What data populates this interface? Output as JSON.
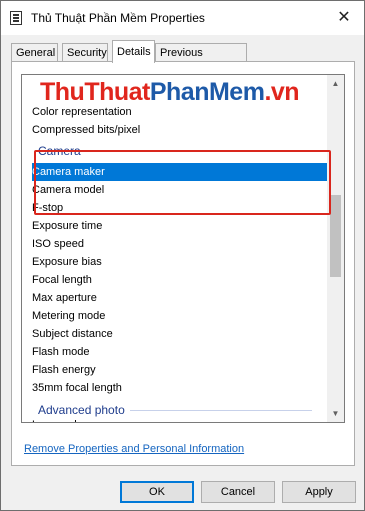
{
  "window": {
    "title": "Thủ Thuật Phần Mềm Properties",
    "close_glyph": "✕"
  },
  "tabs": [
    {
      "label": "General"
    },
    {
      "label": "Security"
    },
    {
      "label": "Details",
      "active": true
    },
    {
      "label": "Previous Versions"
    }
  ],
  "watermark": {
    "part1": "ThuThuat",
    "part2": "PhanMem",
    "part3": ".vn"
  },
  "list": {
    "rows_top": [
      "Color representation",
      "Compressed bits/pixel"
    ],
    "group_camera": "Camera",
    "selected": "Camera maker",
    "camera_model": "Camera model",
    "rows_camera": [
      "F-stop",
      "Exposure time",
      "ISO speed",
      "Exposure bias",
      "Focal length",
      "Max aperture",
      "Metering mode",
      "Subject distance",
      "Flash mode",
      "Flash energy",
      "35mm focal length"
    ],
    "group_advanced": "Advanced photo",
    "row_partial": "Lens maker"
  },
  "scrollbar": {
    "up_glyph": "▲",
    "down_glyph": "▼"
  },
  "link": {
    "text": "Remove Properties and Personal Information"
  },
  "buttons": {
    "ok": "OK",
    "cancel": "Cancel",
    "apply": "Apply"
  },
  "colors": {
    "selection": "#0078d7",
    "highlight_box": "#d9261d",
    "group_header": "#1e3c8c"
  }
}
